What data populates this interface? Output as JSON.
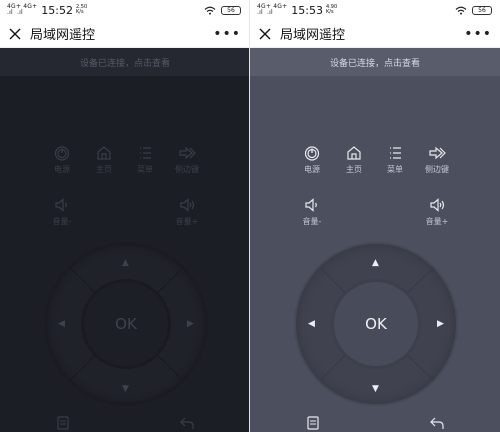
{
  "screens": [
    {
      "status": {
        "signal": "4G+ 4G+\n.ıl  .ıl",
        "time": "15:52",
        "speed": "2.50\nK/s",
        "battery": "56"
      },
      "header": {
        "title": "局域网遥控",
        "more": "•••"
      },
      "hint": "设备已连接，点击查看",
      "buttons": {
        "power": "电源",
        "home": "主页",
        "menu": "菜单",
        "side": "侧边键",
        "vol_down": "音量-",
        "vol_up": "音量+"
      },
      "ok": "OK"
    },
    {
      "status": {
        "signal": "4G+ 4G+\n.ıl  .ıl",
        "time": "15:53",
        "speed": "4.90\nK/s",
        "battery": "56"
      },
      "header": {
        "title": "局域网遥控",
        "more": "•••"
      },
      "hint": "设备已连接，点击查看",
      "buttons": {
        "power": "电源",
        "home": "主页",
        "menu": "菜单",
        "side": "侧边键",
        "vol_down": "音量-",
        "vol_up": "音量+"
      },
      "ok": "OK"
    }
  ]
}
